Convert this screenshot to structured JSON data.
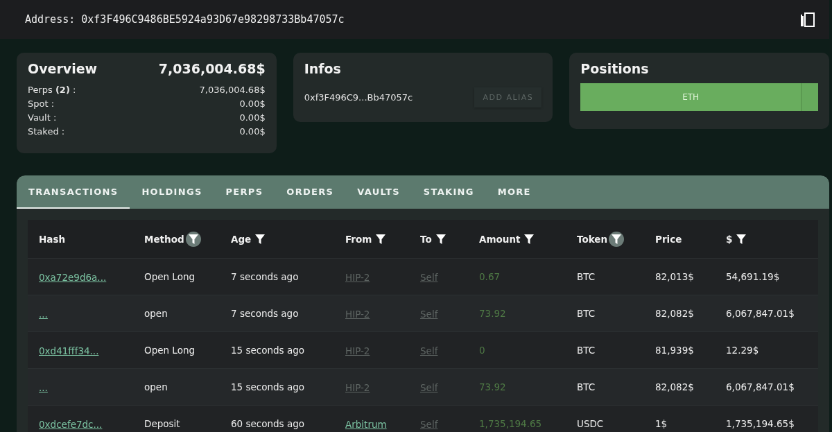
{
  "address": {
    "label": "Address:",
    "value": "0xf3F496C9486BE5924a93D67e98298733Bb47057c"
  },
  "overview": {
    "title": "Overview",
    "total": "7,036,004.68$",
    "rows": [
      {
        "label": "Perps **(2)** :",
        "value": "7,036,004.68$"
      },
      {
        "label": "Spot :",
        "value": "0.00$"
      },
      {
        "label": "Vault :",
        "value": "0.00$"
      },
      {
        "label": "Staked :",
        "value": "0.00$"
      }
    ]
  },
  "infos": {
    "title": "Infos",
    "short_address": "0xf3F496C9...Bb47057c",
    "button": "ADD ALIAS"
  },
  "positions": {
    "title": "Positions",
    "bar": {
      "label": "ETH",
      "level": 0.93
    }
  },
  "tabs": [
    {
      "label": "TRANSACTIONS",
      "selected": true
    },
    {
      "label": "HOLDINGS",
      "selected": false
    },
    {
      "label": "PERPS",
      "selected": false
    },
    {
      "label": "ORDERS",
      "selected": false
    },
    {
      "label": "VAULTS",
      "selected": false
    },
    {
      "label": "STAKING",
      "selected": false
    },
    {
      "label": "MORE",
      "selected": false
    }
  ],
  "table": {
    "columns": [
      {
        "label": "Hash",
        "filter": false
      },
      {
        "label": "Method",
        "filter": true,
        "filter_highlighted": true
      },
      {
        "label": "Age",
        "filter": true,
        "filter_highlighted": false
      },
      {
        "label": "From",
        "filter": true,
        "filter_highlighted": false
      },
      {
        "label": "To",
        "filter": true,
        "filter_highlighted": false
      },
      {
        "label": "Amount",
        "filter": true,
        "filter_highlighted": false
      },
      {
        "label": "Token",
        "filter": true,
        "filter_highlighted": true
      },
      {
        "label": "Price",
        "filter": false
      },
      {
        "label": "$",
        "filter": true,
        "filter_highlighted": false
      }
    ],
    "rows": [
      {
        "hash": "0xa72e9d6a...",
        "method": "Open Long",
        "age": "7 seconds ago",
        "from": {
          "text": "HIP-2",
          "dim": true
        },
        "to": "Self",
        "amount": "0.67",
        "token": "BTC",
        "price": "82,013$",
        "usd": "54,691.19$"
      },
      {
        "hash": "...",
        "method": "open",
        "age": "7 seconds ago",
        "from": {
          "text": "HIP-2",
          "dim": true
        },
        "to": "Self",
        "amount": "73.92",
        "token": "BTC",
        "price": "82,082$",
        "usd": "6,067,847.01$"
      },
      {
        "hash": "0xd41fff34...",
        "method": "Open Long",
        "age": "15 seconds ago",
        "from": {
          "text": "HIP-2",
          "dim": true
        },
        "to": "Self",
        "amount": "0",
        "token": "BTC",
        "price": "81,939$",
        "usd": "12.29$"
      },
      {
        "hash": "...",
        "method": "open",
        "age": "15 seconds ago",
        "from": {
          "text": "HIP-2",
          "dim": true
        },
        "to": "Self",
        "amount": "73.92",
        "token": "BTC",
        "price": "82,082$",
        "usd": "6,067,847.01$"
      },
      {
        "hash": "0xdcefe7dc...",
        "method": "Deposit",
        "age": "60 seconds ago",
        "from": {
          "text": "Arbitrum",
          "dim": false
        },
        "to": "Self",
        "amount": "1,735,194.65",
        "token": "USDC",
        "price": "1$",
        "usd": "1,735,194.65$"
      }
    ]
  }
}
